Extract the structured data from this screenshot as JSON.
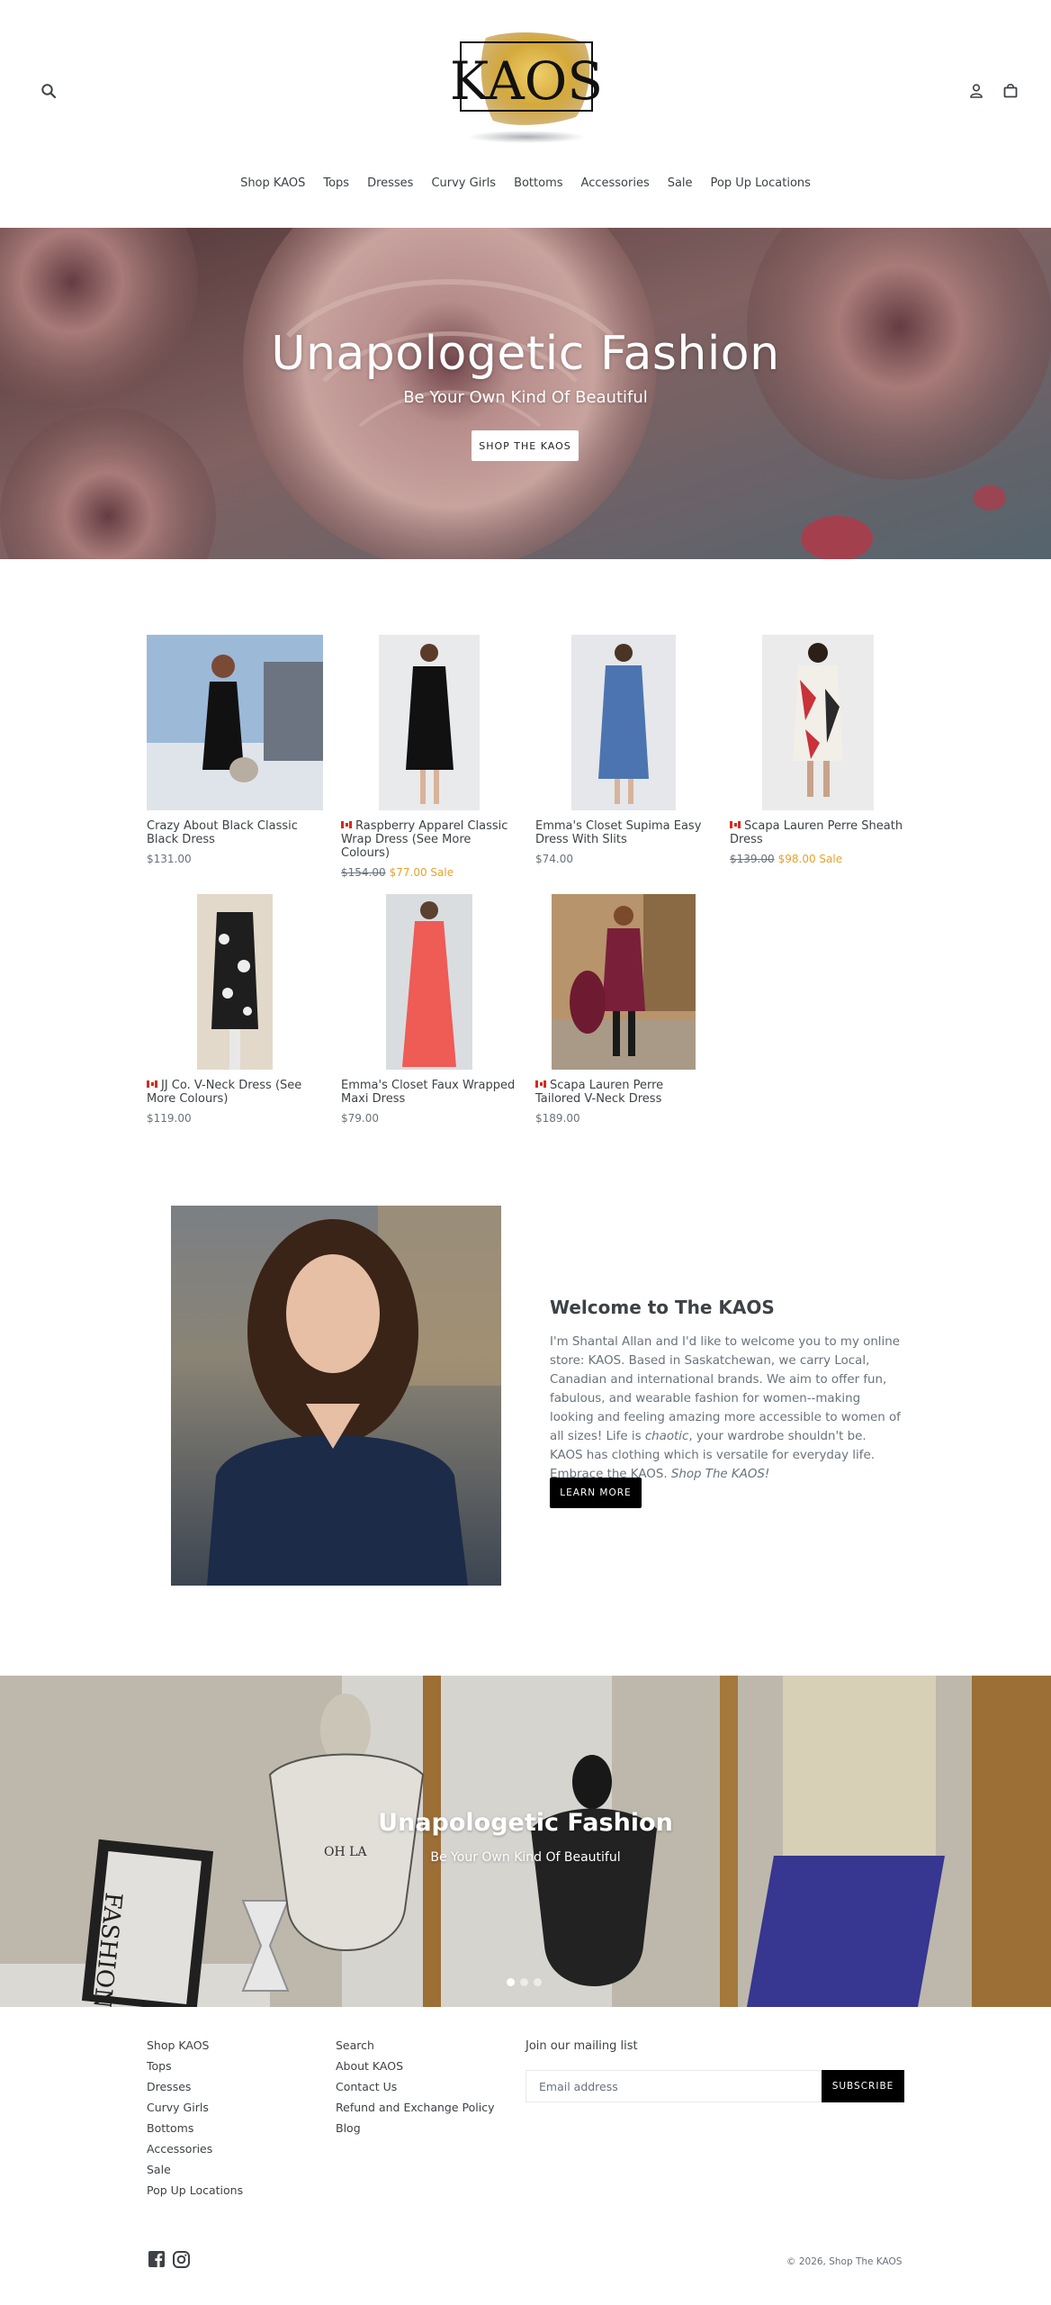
{
  "header": {
    "logo_text": "KAOS",
    "nav": [
      "Shop KAOS",
      "Tops",
      "Dresses",
      "Curvy Girls",
      "Bottoms",
      "Accessories",
      "Sale",
      "Pop Up Locations"
    ]
  },
  "hero": {
    "title": "Unapologetic Fashion",
    "subtitle": "Be Your Own Kind Of Beautiful",
    "button_label": "SHOP THE KAOS"
  },
  "products": [
    {
      "title": "Crazy About Black Classic Black Dress",
      "flag": false,
      "price": "$131.00",
      "old_price": "",
      "sale_price": ""
    },
    {
      "title": "Raspberry Apparel Classic Wrap Dress (See More Colours)",
      "flag": true,
      "price": "",
      "old_price": "$154.00",
      "sale_price": "$77.00 Sale"
    },
    {
      "title": "Emma's Closet Supima Easy Dress With Slits",
      "flag": false,
      "price": "$74.00",
      "old_price": "",
      "sale_price": ""
    },
    {
      "title": "Scapa Lauren Perre Sheath Dress",
      "flag": true,
      "price": "",
      "old_price": "$139.00",
      "sale_price": "$98.00 Sale"
    },
    {
      "title": "JJ Co. V-Neck Dress (See More Colours)",
      "flag": true,
      "price": "$119.00",
      "old_price": "",
      "sale_price": ""
    },
    {
      "title": "Emma's Closet Faux Wrapped Maxi Dress",
      "flag": false,
      "price": "$79.00",
      "old_price": "",
      "sale_price": ""
    },
    {
      "title": "Scapa Lauren Perre Tailored V-Neck Dress",
      "flag": true,
      "price": "$189.00",
      "old_price": "",
      "sale_price": ""
    }
  ],
  "welcome": {
    "title": "Welcome to The KAOS",
    "body_part1": "I'm Shantal Allan and I'd like to welcome you to my online store: KAOS. Based in Saskatchewan, we carry Local, Canadian and international brands. We aim to offer fun, fabulous, and wearable fashion for women--making looking and feeling amazing more accessible to women of all sizes! Life is ",
    "body_em1": "chaotic",
    "body_part2": ", your wardrobe shouldn't be. KAOS has clothing which is versatile for everyday life. Embrace the KAOS. ",
    "body_em2": "Shop The KAOS!",
    "button_label": "LEARN MORE"
  },
  "slideshow": {
    "title": "Unapologetic Fashion",
    "subtitle": "Be Your Own Kind Of Beautiful",
    "book_text": "FASHION",
    "active_slide": 1,
    "slide_count": 3
  },
  "footer": {
    "col1": [
      "Shop KAOS",
      "Tops",
      "Dresses",
      "Curvy Girls",
      "Bottoms",
      "Accessories",
      "Sale",
      "Pop Up Locations"
    ],
    "col2": [
      "Search",
      "About KAOS",
      "Contact Us",
      "Refund and Exchange Policy",
      "Blog"
    ],
    "mailing_label": "Join our mailing list",
    "email_placeholder": "Email address",
    "subscribe_label": "SUBSCRIBE",
    "copyright": "© 2026, Shop The KAOS"
  },
  "colors": {
    "text": "#3d4246",
    "muted": "#69727b",
    "sale": "#e5a32a",
    "button_dark": "#000000",
    "logo_gold": "#d4a93c"
  }
}
